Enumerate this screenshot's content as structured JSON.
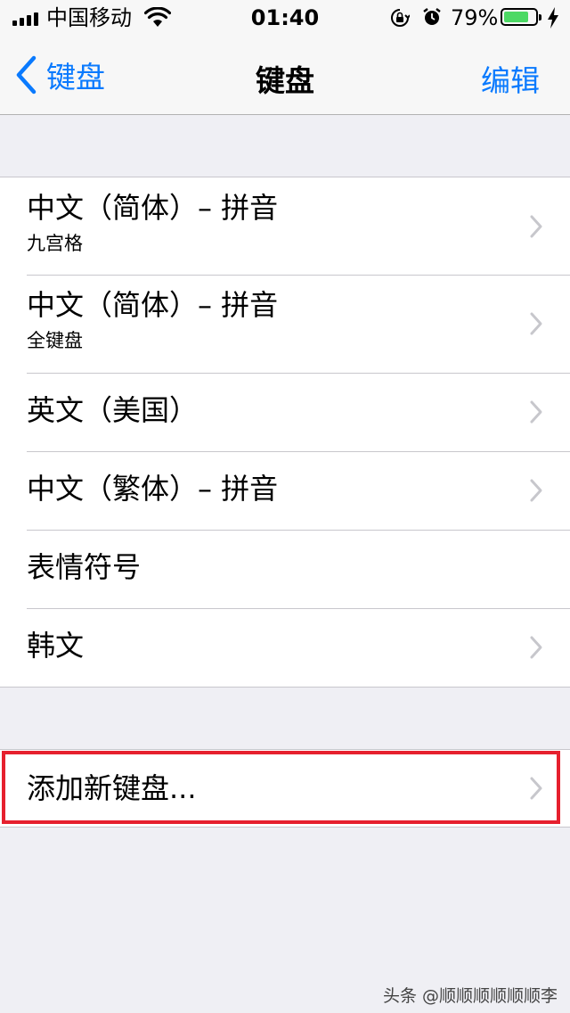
{
  "status_bar": {
    "carrier": "中国移动",
    "time": "01:40",
    "battery_percent": "79%",
    "battery_level": 0.79,
    "battery_color": "#4cd964"
  },
  "nav": {
    "back_label": "键盘",
    "title": "键盘",
    "edit_label": "编辑",
    "accent_color": "#0a7afe"
  },
  "keyboards": [
    {
      "title": "中文（简体）– 拼音",
      "subtitle": "九宫格",
      "chevron": true
    },
    {
      "title": "中文（简体）– 拼音",
      "subtitle": "全键盘",
      "chevron": true
    },
    {
      "title": "英文（美国）",
      "subtitle": "",
      "chevron": true
    },
    {
      "title": "中文（繁体）– 拼音",
      "subtitle": "",
      "chevron": true
    },
    {
      "title": "表情符号",
      "subtitle": "",
      "chevron": false
    },
    {
      "title": "韩文",
      "subtitle": "",
      "chevron": true
    }
  ],
  "add_keyboard": {
    "label": "添加新键盘...",
    "highlight_color": "#e6202e"
  },
  "watermark": "头条 @顺顺顺顺顺顺李"
}
